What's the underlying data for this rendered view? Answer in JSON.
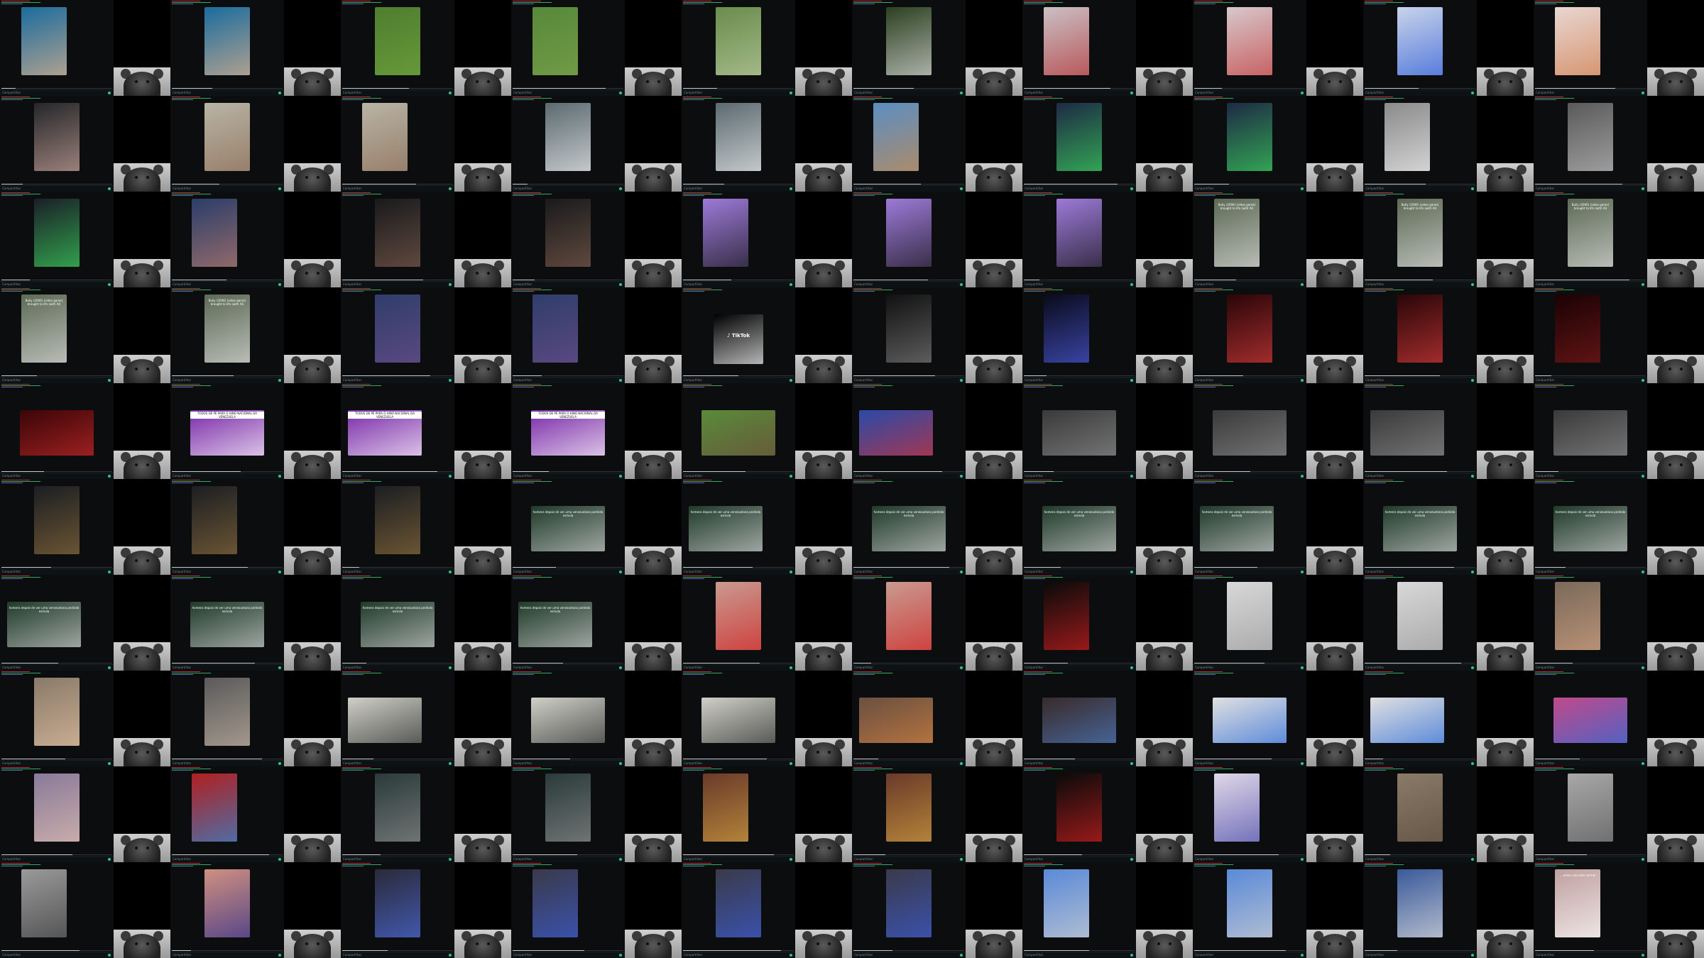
{
  "grid": {
    "title": "",
    "tiles": [
      {
        "caption": "",
        "bg": "#1a6c9e",
        "accent": "#e8b58a",
        "status": "Compartilhar"
      },
      {
        "caption": "",
        "bg": "#1a6c9e",
        "accent": "#e8b58a",
        "status": "Compartilhar"
      },
      {
        "caption": "",
        "bg": "#4f7e2f",
        "accent": "#6fa33d",
        "status": "Compartilhar"
      },
      {
        "caption": "",
        "bg": "#56893a",
        "accent": "#7ca14a",
        "status": "Compartilhar"
      },
      {
        "caption": "",
        "bg": "#6a8d4c",
        "accent": "#b9c9a0",
        "status": "Compartilhar"
      },
      {
        "caption": "",
        "bg": "#2b4020",
        "accent": "#dddddd",
        "status": "Compartilhar"
      },
      {
        "caption": "",
        "bg": "#c9c0c5",
        "accent": "#b23030",
        "status": "Compartilhar"
      },
      {
        "caption": "",
        "bg": "#d7c8cc",
        "accent": "#c23a3a",
        "status": "Compartilhar"
      },
      {
        "caption": "",
        "bg": "#c9d3ea",
        "accent": "#2b5bd6",
        "status": "Compartilhar"
      },
      {
        "caption": "",
        "bg": "#e8d7d2",
        "accent": "#cf7c4a",
        "status": "Compartilhar"
      },
      {
        "caption": "",
        "bg": "#25262a",
        "accent": "#c9a49a",
        "status": "Compartilhar"
      },
      {
        "caption": "",
        "bg": "#b9b4a6",
        "accent": "#8a6a52",
        "status": "Compartilhar"
      },
      {
        "caption": "",
        "bg": "#b9b4a6",
        "accent": "#8a6a52",
        "status": "Compartilhar"
      },
      {
        "caption": "",
        "bg": "#5b6a70",
        "accent": "#ededed",
        "status": "Compartilhar"
      },
      {
        "caption": "",
        "bg": "#5b6a70",
        "accent": "#ededed",
        "status": "Compartilhar"
      },
      {
        "caption": "",
        "bg": "#5b8ec2",
        "accent": "#c98a4a",
        "status": "Compartilhar"
      },
      {
        "caption": "",
        "bg": "#1d2a44",
        "accent": "#3bd35b",
        "status": "Compartilhar"
      },
      {
        "caption": "",
        "bg": "#1d2a44",
        "accent": "#3bd35b",
        "status": "Compartilhar"
      },
      {
        "caption": "",
        "bg": "#8a8a8a",
        "accent": "#f0f0f0",
        "status": "Compartilhar"
      },
      {
        "caption": "",
        "bg": "#5a5a5a",
        "accent": "#b7b7b7",
        "status": "Compartilhar"
      },
      {
        "caption": "",
        "bg": "#1a1f28",
        "accent": "#3bd35b",
        "status": "Compartilhar"
      },
      {
        "caption": "",
        "bg": "#2b3d6a",
        "accent": "#b87b6a",
        "status": "Compartilhar"
      },
      {
        "caption": "",
        "bg": "#191a1c",
        "accent": "#7b5b4b",
        "status": "Compartilhar"
      },
      {
        "caption": "",
        "bg": "#191a1c",
        "accent": "#7b5b4b",
        "status": "Compartilhar"
      },
      {
        "caption": "",
        "bg": "#9d7ad8",
        "accent": "#111111",
        "status": "Compartilhar"
      },
      {
        "caption": "",
        "bg": "#9d7ad8",
        "accent": "#111111",
        "status": "Compartilhar"
      },
      {
        "caption": "",
        "bg": "#9d7ad8",
        "accent": "#111111",
        "status": "Compartilhar"
      },
      {
        "caption": "Bully (2006) (video game) brought to life (with AI)",
        "bg": "#5d6a55",
        "accent": "#dddddd",
        "status": "Compartilhar"
      },
      {
        "caption": "Bully (2006) (video game) brought to life (with AI)",
        "bg": "#5d6a55",
        "accent": "#dddddd",
        "status": "Compartilhar"
      },
      {
        "caption": "Bully (2006) (video game) brought to life (with AI)",
        "bg": "#5d6a55",
        "accent": "#dddddd",
        "status": "Compartilhar"
      },
      {
        "caption": "Bully (2006) (video game) brought to life (with AI)",
        "bg": "#5d6a55",
        "accent": "#dddddd",
        "status": "Compartilhar"
      },
      {
        "caption": "Bully (2006) (video game) brought to life (with AI)",
        "bg": "#5d6a55",
        "accent": "#dddddd",
        "status": "Compartilhar"
      },
      {
        "caption": "",
        "bg": "#2f3e6a",
        "accent": "#6b4c8a",
        "status": "Compartilhar"
      },
      {
        "caption": "",
        "bg": "#2f3e6a",
        "accent": "#6b4c8a",
        "status": "Compartilhar"
      },
      {
        "caption": "TikTok",
        "bg": "#000000",
        "accent": "#ffffff",
        "status": "Compartilhar"
      },
      {
        "caption": "",
        "bg": "#111111",
        "accent": "#7a7a7a",
        "status": "Compartilhar"
      },
      {
        "caption": "",
        "bg": "#0a0a1a",
        "accent": "#4b5ad8",
        "status": "Compartilhar"
      },
      {
        "caption": "",
        "bg": "#2a0608",
        "accent": "#d03a3a",
        "status": "Compartilhar"
      },
      {
        "caption": "",
        "bg": "#2a0608",
        "accent": "#d03a3a",
        "status": "Compartilhar"
      },
      {
        "caption": "",
        "bg": "#1b0204",
        "accent": "#7a1a1a",
        "status": "Compartilhar"
      },
      {
        "caption": "",
        "bg": "#3b0507",
        "accent": "#c22a2a",
        "status": "Compartilhar"
      },
      {
        "caption": "TODOS DE PÉ PARA O HINO NACIONAL DA VENEZUELA",
        "bg": "#7a2aa8",
        "accent": "#ffffff",
        "status": "Compartilhar"
      },
      {
        "caption": "TODOS DE PÉ PARA O HINO NACIONAL DA VENEZUELA",
        "bg": "#7a2aa8",
        "accent": "#ffffff",
        "status": "Compartilhar"
      },
      {
        "caption": "TODOS DE PÉ PARA O HINO NACIONAL DA VENEZUELA",
        "bg": "#7a2aa8",
        "accent": "#ffffff",
        "status": "Compartilhar"
      },
      {
        "caption": "",
        "bg": "#5a8a3a",
        "accent": "#6b4a3a",
        "status": "Compartilhar"
      },
      {
        "caption": "",
        "bg": "#2a4aa8",
        "accent": "#d03030",
        "status": "Compartilhar"
      },
      {
        "caption": "",
        "bg": "#3a3a3a",
        "accent": "#8a8a8a",
        "status": "Compartilhar"
      },
      {
        "caption": "",
        "bg": "#3a3a3a",
        "accent": "#8a8a8a",
        "status": "Compartilhar"
      },
      {
        "caption": "",
        "bg": "#3a3a3a",
        "accent": "#8a8a8a",
        "status": "Compartilhar"
      },
      {
        "caption": "",
        "bg": "#3a3a3a",
        "accent": "#8a8a8a",
        "status": "Compartilhar"
      },
      {
        "caption": "",
        "bg": "#1b1e22",
        "accent": "#8a6a3a",
        "status": "Compartilhar"
      },
      {
        "caption": "",
        "bg": "#1b1e22",
        "accent": "#8a6a3a",
        "status": "Compartilhar"
      },
      {
        "caption": "",
        "bg": "#1b1e22",
        "accent": "#8a6a3a",
        "status": "Compartilhar"
      },
      {
        "caption": "homens depois de ver uma venezuelana pedindo esmola",
        "bg": "#1f3a2a",
        "accent": "#d0d0d0",
        "status": "Compartilhar"
      },
      {
        "caption": "homens depois de ver uma venezuelana pedindo esmola",
        "bg": "#1f3a2a",
        "accent": "#d0d0d0",
        "status": "Compartilhar"
      },
      {
        "caption": "homens depois de ver uma venezuelana pedindo esmola",
        "bg": "#1f3a2a",
        "accent": "#d0d0d0",
        "status": "Compartilhar"
      },
      {
        "caption": "homens depois de ver uma venezuelana pedindo esmola",
        "bg": "#1f3a2a",
        "accent": "#d0d0d0",
        "status": "Compartilhar"
      },
      {
        "caption": "homens depois de ver uma venezuelana pedindo esmola",
        "bg": "#1f3a2a",
        "accent": "#d0d0d0",
        "status": "Compartilhar"
      },
      {
        "caption": "homens depois de ver uma venezuelana pedindo esmola",
        "bg": "#1f3a2a",
        "accent": "#d0d0d0",
        "status": "Compartilhar"
      },
      {
        "caption": "homens depois de ver uma venezuelana pedindo esmola",
        "bg": "#1f3a2a",
        "accent": "#d0d0d0",
        "status": "Compartilhar"
      },
      {
        "caption": "homens depois de ver uma venezuelana pedindo esmola",
        "bg": "#1f3a2a",
        "accent": "#d0d0d0",
        "status": "Compartilhar"
      },
      {
        "caption": "homens depois de ver uma venezuelana pedindo esmola",
        "bg": "#1f3a2a",
        "accent": "#d0d0d0",
        "status": "Compartilhar"
      },
      {
        "caption": "homens depois de ver uma venezuelana pedindo esmola",
        "bg": "#1f3a2a",
        "accent": "#d0d0d0",
        "status": "Compartilhar"
      },
      {
        "caption": "homens depois de ver uma venezuelana pedindo esmola",
        "bg": "#1f3a2a",
        "accent": "#d0d0d0",
        "status": "Compartilhar"
      },
      {
        "caption": "",
        "bg": "#c99a90",
        "accent": "#d02020",
        "status": "Compartilhar"
      },
      {
        "caption": "",
        "bg": "#c99a90",
        "accent": "#d02020",
        "status": "Compartilhar"
      },
      {
        "caption": "",
        "bg": "#0a0a0a",
        "accent": "#d02020",
        "status": "Compartilhar"
      },
      {
        "caption": "",
        "bg": "#d8d8d8",
        "accent": "#9a9a9a",
        "status": "Compartilhar"
      },
      {
        "caption": "",
        "bg": "#d8d8d8",
        "accent": "#9a9a9a",
        "status": "Compartilhar"
      },
      {
        "caption": "",
        "bg": "#7a6a5a",
        "accent": "#d0a080",
        "status": "Compartilhar"
      },
      {
        "caption": "",
        "bg": "#8a7a6a",
        "accent": "#e0c0a0",
        "status": "Compartilhar"
      },
      {
        "caption": "",
        "bg": "#5a5a5a",
        "accent": "#c0b0a0",
        "status": "Compartilhar"
      },
      {
        "caption": "",
        "bg": "#d0d0c8",
        "accent": "#2a2a2a",
        "status": "Compartilhar"
      },
      {
        "caption": "",
        "bg": "#d0d0c8",
        "accent": "#2a2a2a",
        "status": "Compartilhar"
      },
      {
        "caption": "",
        "bg": "#d0d0c8",
        "accent": "#2a2a2a",
        "status": "Compartilhar"
      },
      {
        "caption": "",
        "bg": "#6a5040",
        "accent": "#d08040",
        "status": "Compartilhar"
      },
      {
        "caption": "",
        "bg": "#3a2a2a",
        "accent": "#4a7ac0",
        "status": "Compartilhar"
      },
      {
        "caption": "",
        "bg": "#e0e0e0",
        "accent": "#2a6ad8",
        "status": "Compartilhar"
      },
      {
        "caption": "",
        "bg": "#e0e0e0",
        "accent": "#2a6ad8",
        "status": "Compartilhar"
      },
      {
        "caption": "",
        "bg": "#c04a8a",
        "accent": "#2a6ad8",
        "status": "Compartilhar"
      },
      {
        "caption": "",
        "bg": "#8a7a9a",
        "accent": "#e0c0b0",
        "status": "Compartilhar"
      },
      {
        "caption": "",
        "bg": "#b02020",
        "accent": "#2a8ad8",
        "status": "Compartilhar"
      },
      {
        "caption": "",
        "bg": "#2a3a3a",
        "accent": "#8a8a8a",
        "status": "Compartilhar"
      },
      {
        "caption": "",
        "bg": "#2a3a3a",
        "accent": "#8a8a8a",
        "status": "Compartilhar"
      },
      {
        "caption": "",
        "bg": "#6a3a2a",
        "accent": "#d0a040",
        "status": "Compartilhar"
      },
      {
        "caption": "",
        "bg": "#6a3a2a",
        "accent": "#d0a040",
        "status": "Compartilhar"
      },
      {
        "caption": "",
        "bg": "#0a0a0a",
        "accent": "#d02020",
        "status": "Compartilhar"
      },
      {
        "caption": "",
        "bg": "#e0d8e8",
        "accent": "#4a4aa8",
        "status": "Compartilhar"
      },
      {
        "caption": "",
        "bg": "#8a7a6a",
        "accent": "#5a4a3a",
        "status": "Compartilhar"
      },
      {
        "caption": "",
        "bg": "#a8a8a8",
        "accent": "#5a5a5a",
        "status": "Compartilhar"
      },
      {
        "caption": "",
        "bg": "#9a9a9a",
        "accent": "#3a3a3a",
        "status": "Compartilhar"
      },
      {
        "caption": "",
        "bg": "#d09080",
        "accent": "#2a2a8a",
        "status": "Compartilhar"
      },
      {
        "caption": "",
        "bg": "#2a2a3a",
        "accent": "#4a6ad8",
        "status": "Compartilhar"
      },
      {
        "caption": "",
        "bg": "#3a3a4a",
        "accent": "#3a5ad0",
        "status": "Compartilhar"
      },
      {
        "caption": "",
        "bg": "#3a3a4a",
        "accent": "#3a5ad0",
        "status": "Compartilhar"
      },
      {
        "caption": "",
        "bg": "#3a3a4a",
        "accent": "#3a5ad0",
        "status": "Compartilhar"
      },
      {
        "caption": "",
        "bg": "#5a8ad8",
        "accent": "#d0d0d0",
        "status": "Compartilhar"
      },
      {
        "caption": "",
        "bg": "#5a8ad8",
        "accent": "#d0d0d0",
        "status": "Compartilhar"
      },
      {
        "caption": "",
        "bg": "#3a5a9a",
        "accent": "#e0e0e0",
        "status": "Compartilhar"
      },
      {
        "caption": "... emas uma foto normal",
        "bg": "#c0a0a0",
        "accent": "#ffffff",
        "status": "Compartilhar"
      }
    ]
  }
}
